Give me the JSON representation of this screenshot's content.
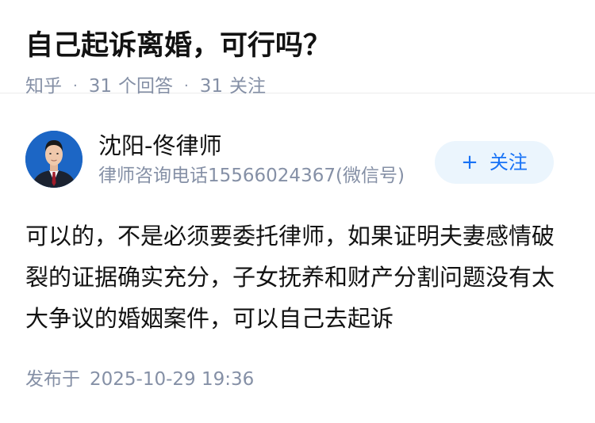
{
  "question": {
    "title": "自己起诉离婚，可行吗？",
    "source": "知乎",
    "answer_count": "31",
    "answer_label": "个回答",
    "follower_count": "31",
    "follower_label": "关注"
  },
  "answer": {
    "author": {
      "name": "沈阳-佟律师",
      "headline": "律师咨询电话15566024367(微信号)",
      "avatar_icon": "lawyer-portrait"
    },
    "follow_button": {
      "plus": "+",
      "label": "关注"
    },
    "content": "可以的，不是必须要委托律师，如果证明夫妻感情破裂的证据确实充分，子女抚养和财产分割问题没有太大争议的婚姻案件，可以自己去起诉",
    "published_label": "发布于",
    "published_time": "2025-10-29 19:36"
  },
  "colors": {
    "primary_text": "#121212",
    "secondary_text": "#8590a6",
    "accent": "#1772f6",
    "follow_bg": "#ebf5fd",
    "avatar_bg": "#1c66c5"
  }
}
